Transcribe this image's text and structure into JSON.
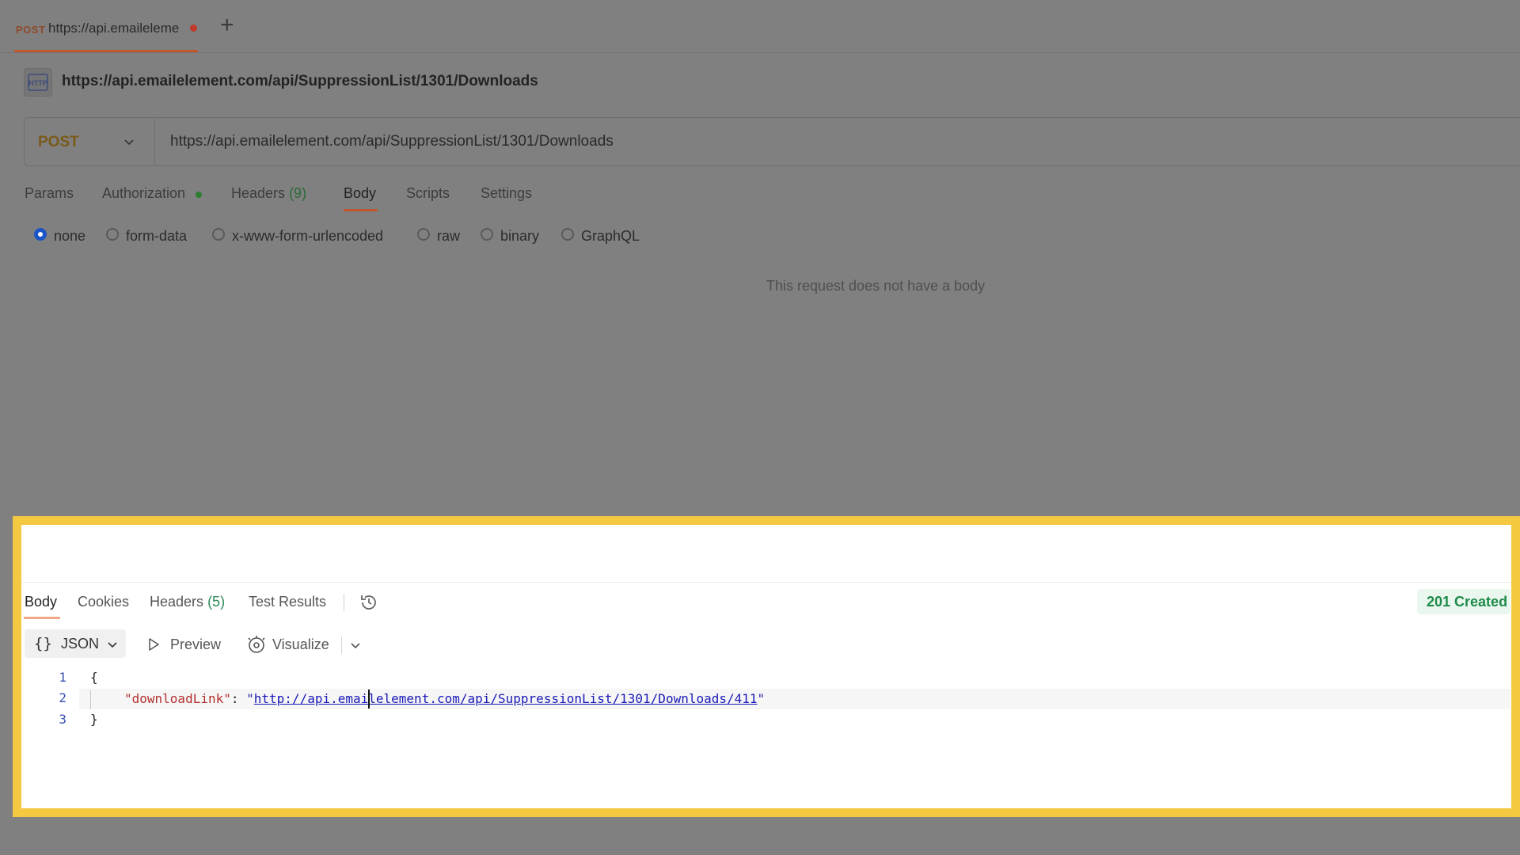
{
  "tab": {
    "method": "POST",
    "url": "https://api.emaileleme"
  },
  "request": {
    "title": "https://api.emailelement.com/api/SuppressionList/1301/Downloads",
    "method": "POST",
    "url": "https://api.emailelement.com/api/SuppressionList/1301/Downloads",
    "tabs": {
      "params": "Params",
      "authorization": "Authorization",
      "headers": "Headers",
      "headers_count": "(9)",
      "body": "Body",
      "scripts": "Scripts",
      "settings": "Settings"
    },
    "body_types": [
      "none",
      "form-data",
      "x-www-form-urlencoded",
      "raw",
      "binary",
      "GraphQL"
    ],
    "selected_body_type": "none",
    "empty_message": "This request does not have a body"
  },
  "response": {
    "tabs": {
      "body": "Body",
      "cookies": "Cookies",
      "headers": "Headers",
      "headers_count": "(5)",
      "test_results": "Test Results"
    },
    "status": "201 Created",
    "format": "JSON",
    "preview_label": "Preview",
    "visualize_label": "Visualize",
    "code": {
      "line_numbers": [
        "1",
        "2",
        "3"
      ],
      "open_brace": "{",
      "key": "\"downloadLink\"",
      "colon": ": ",
      "value": "http://api.emailelement.com/api/SuppressionList/1301/Downloads/411",
      "close_brace": "}"
    }
  },
  "colors": {
    "highlight_border": "#f5c842",
    "status_green": "#1e8a4a",
    "accent_orange": "#c0562c",
    "radio_blue": "#1c55c7"
  },
  "icons": [
    "http-request-icon",
    "plus-icon",
    "chevron-down-icon",
    "history-icon",
    "play-icon",
    "visualize-icon"
  ]
}
